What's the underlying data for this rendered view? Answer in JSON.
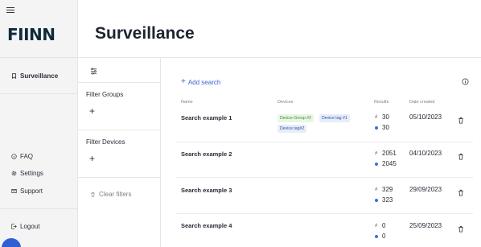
{
  "app": {
    "logo": "FIINN"
  },
  "sidebar": {
    "nav": [
      {
        "label": "Surveillance",
        "icon": "bookmark-icon"
      }
    ],
    "footer": [
      {
        "label": "FAQ",
        "icon": "help-circle-icon"
      },
      {
        "label": "Settings",
        "icon": "gear-icon"
      },
      {
        "label": "Support",
        "icon": "mail-icon"
      }
    ],
    "logout": {
      "label": "Logout",
      "icon": "logout-icon"
    }
  },
  "page": {
    "title": "Surveillance"
  },
  "filters": {
    "groups_label": "Filter Groups",
    "devices_label": "Filter Devices",
    "add_symbol": "+",
    "clear_label": "Clear filters"
  },
  "toolbar": {
    "add_search_label": "Add search"
  },
  "table": {
    "columns": [
      "Name",
      "Devices",
      "Results",
      "Date created"
    ],
    "rows": [
      {
        "name": "Search example 1",
        "tags": [
          "Device Group #2",
          "Device tag #1",
          "Device tag#2"
        ],
        "results_total": "30",
        "results_new": "30",
        "date": "05/10/2023"
      },
      {
        "name": "Search example 2",
        "tags": [],
        "results_total": "2051",
        "results_new": "2045",
        "date": "04/10/2023"
      },
      {
        "name": "Search example 3",
        "tags": [],
        "results_total": "329",
        "results_new": "323",
        "date": "29/09/2023"
      },
      {
        "name": "Search example 4",
        "tags": [],
        "results_total": "0",
        "results_new": "0",
        "date": "25/09/2023"
      }
    ]
  },
  "colors": {
    "accent": "#3d5fd0",
    "tag_green_bg": "#e9f6e6",
    "tag_blue_bg": "#e6edfb",
    "dot": "#3d6fd8"
  }
}
